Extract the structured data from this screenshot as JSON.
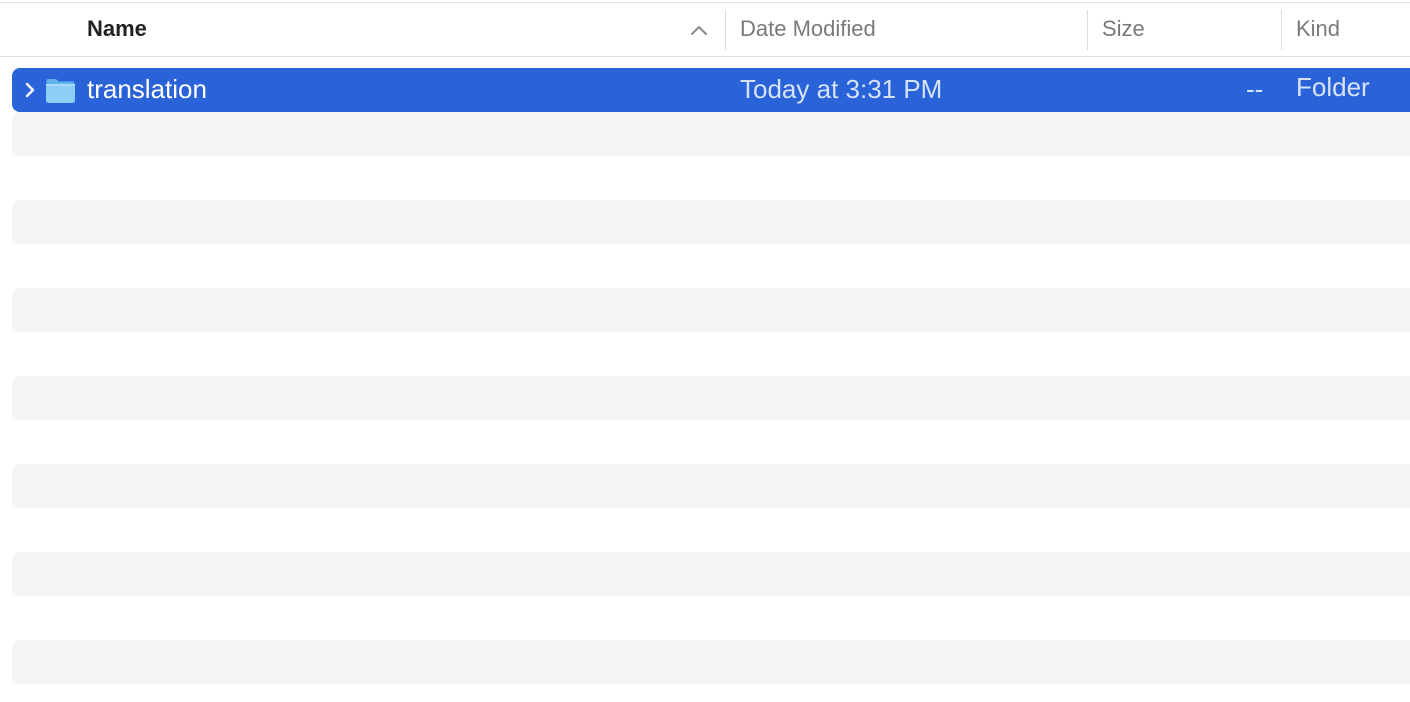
{
  "columns": {
    "name": "Name",
    "date_modified": "Date Modified",
    "size": "Size",
    "kind": "Kind",
    "sort_indicator": "chevron-up-icon"
  },
  "files": [
    {
      "name": "translation",
      "date_modified": "Today at 3:31 PM",
      "size": "--",
      "kind": "Folder",
      "icon": "folder-icon",
      "selected": true,
      "expandable": true
    }
  ],
  "colors": {
    "selection": "#2a63d8",
    "stripe": "#f3f4f4",
    "folder": "#8dcdf6"
  }
}
